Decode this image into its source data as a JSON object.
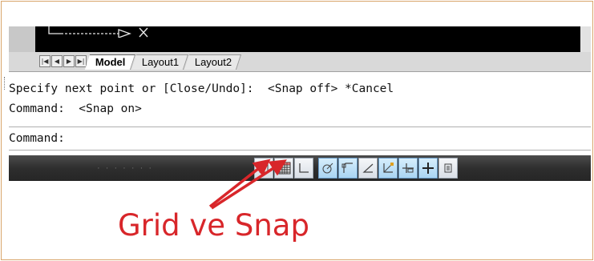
{
  "command_line": {
    "history_1": "Specify next point or [Close/Undo]:  <Snap off> *Cancel",
    "history_2": "Command:  <Snap on>",
    "prompt": "Command:"
  },
  "layout_tabs": [
    {
      "label": "Model",
      "active": true
    },
    {
      "label": "Layout1",
      "active": false
    },
    {
      "label": "Layout2",
      "active": false
    }
  ],
  "tab_nav": [
    "first-tab",
    "previous-tab",
    "next-tab",
    "last-tab"
  ],
  "status_toggles": [
    {
      "name": "snap-mode",
      "on": false
    },
    {
      "name": "grid-display",
      "on": false
    },
    {
      "name": "ortho-mode",
      "on": false
    },
    {
      "name": "polar-tracking",
      "on": true
    },
    {
      "name": "object-snap",
      "on": true
    },
    {
      "name": "object-snap-tracking",
      "on": false
    },
    {
      "name": "dynamic-ucs",
      "on": false
    },
    {
      "name": "dynamic-input",
      "on": true
    },
    {
      "name": "lineweight",
      "on": true
    },
    {
      "name": "quick-properties",
      "on": false
    }
  ],
  "annotation": {
    "caption": "Grid ve Snap",
    "color": "#d8262a"
  },
  "colors": {
    "drawing_background": "#000000",
    "status_bar": "#2e2e2e",
    "frame_border": "#d9a56b"
  }
}
